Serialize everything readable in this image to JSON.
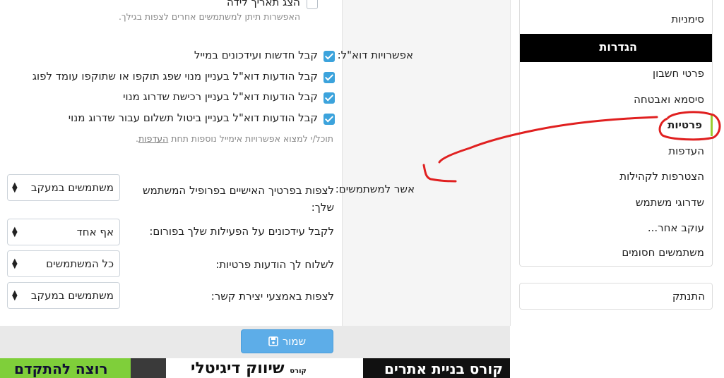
{
  "privacy": {
    "birthday": {
      "label": "הצג תאריך לידה",
      "checked": false,
      "hint": "האפשרות תיתן למשתמשים אחרים לצפות בגילך."
    }
  },
  "email_options": {
    "section_label": "אפשרויות דוא\"ל:",
    "items": [
      {
        "label": "קבל חדשות ועידכונים במייל",
        "checked": true
      },
      {
        "label": "קבל הודעות דוא\"ל בעניין מנוי שפג תוקפו או שתוקפו עומד לפוג",
        "checked": true
      },
      {
        "label": "קבל הודעות דוא\"ל בעניין רכישת שדרוג מנוי",
        "checked": true
      },
      {
        "label": "קבל הודעות דוא\"ל בעניין ביטול תשלום עבור שדרוג מנוי",
        "checked": true
      }
    ],
    "hint_prefix": "תוכל/י למצוא אפשרויות אימייל נוספות תחת ",
    "hint_link": "העדפות",
    "hint_suffix": "."
  },
  "allow_users": {
    "section_label": "אשר למשתמשים:",
    "rows": [
      {
        "question": "לצפות בפרטיך האישיים בפרופיל המשתמש שלך:",
        "value": "משתמשים במעקב"
      },
      {
        "question": "לקבל עידכונים על הפעילות שלך בפורום:",
        "value": "אף אחד"
      },
      {
        "question": "לשלוח לך הודעות פרטיות:",
        "value": "כל המשתמשים"
      },
      {
        "question": "לצפות באמצעי יצירת קשר:",
        "value": "משתמשים במעקב"
      }
    ]
  },
  "save_label": "שמור",
  "ad": {
    "left_text": "רוצה להתקדם",
    "mid_text": "שיווק דיגיטלי",
    "mid_small": "קורס",
    "right_text": "קורס בניית אתרים"
  },
  "sidebar": {
    "top_item": "סימניות",
    "header": "הגדרות",
    "items": [
      {
        "label": "פרטי חשבון",
        "active": false
      },
      {
        "label": "סיסמא ואבטחה",
        "active": false
      },
      {
        "label": "פרטיות",
        "active": true
      },
      {
        "label": "העדפות",
        "active": false
      },
      {
        "label": "הצטרפות לקהילות",
        "active": false
      },
      {
        "label": "שדרוגי משתמש",
        "active": false
      },
      {
        "label": "עוקב אחר...",
        "active": false
      },
      {
        "label": "משתמשים חסומים",
        "active": false
      }
    ],
    "logout": "התנתק"
  },
  "colors": {
    "accent": "#3ca3dc",
    "save_button": "#5dade8",
    "menu_header": "#000000",
    "active_marker": "#9acd32",
    "annotation": "#e02020"
  }
}
